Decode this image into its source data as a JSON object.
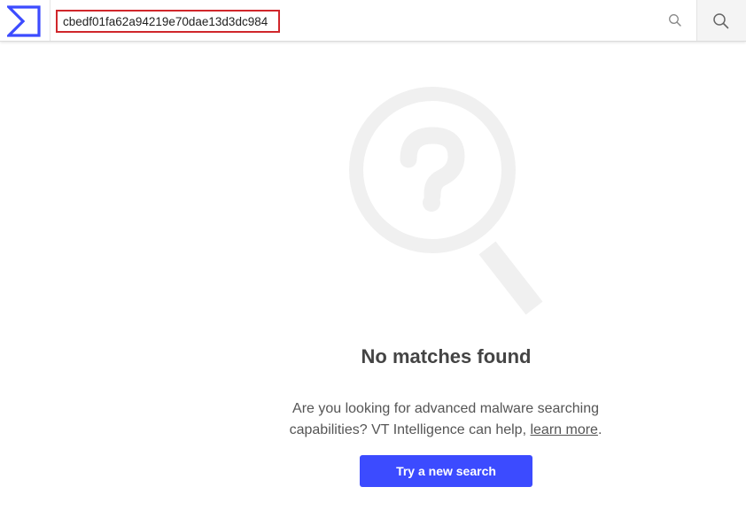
{
  "header": {
    "logo_icon": "virustotal-sigma-logo-icon",
    "search_value": "cbedf01fa62a94219e70dae13d3dc984",
    "inline_icon": "search-icon",
    "button_icon": "search-icon"
  },
  "empty_state": {
    "illustration_icon": "magnifier-question-icon",
    "title": "No matches found",
    "description_prefix": "Are you looking for advanced malware searching capabilities? VT Intelligence can help, ",
    "learn_more": "learn more",
    "description_suffix": ".",
    "cta_label": "Try a new search"
  },
  "colors": {
    "accent": "#3c4bff",
    "logo": "#3c4bff",
    "input_highlight": "#d0262b"
  }
}
